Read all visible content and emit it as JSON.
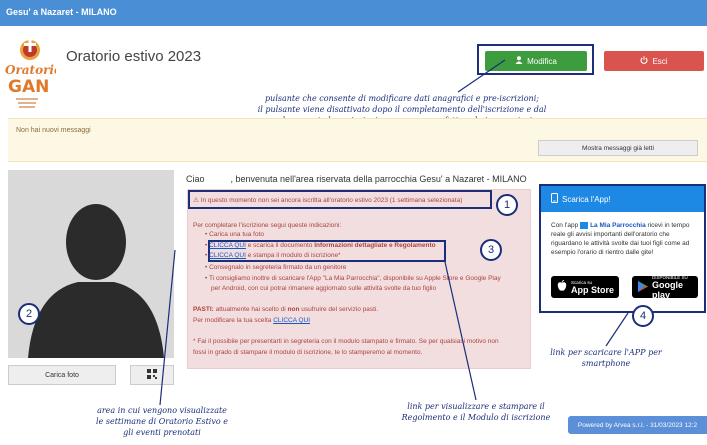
{
  "topbar": {
    "title": "Gesu' a Nazaret - MILANO"
  },
  "logo": {
    "text1": "Oratorio",
    "text2": "GAN"
  },
  "page_title": "Oratorio estivo 2023",
  "buttons": {
    "modifica": "Modifica",
    "esci": "Esci",
    "mostra_messaggi": "Mostra messaggi già letti",
    "carica_foto": "Carica foto"
  },
  "messages": {
    "none": "Non hai nuovi messaggi"
  },
  "welcome": {
    "ciao": "Ciao",
    "text": ", benvenuta nell'area riservata della parrocchia Gesu' a Nazaret - MILANO"
  },
  "alert": {
    "top": "In questo momento non sei ancora iscritta all'oratorio estivo 2023 (1 settimana selezionata)",
    "intro": "Per completare l'iscrizione segui queste indicazioni:",
    "step1": "Carica una tua foto",
    "step2_link": "CLICCA QUI",
    "step2_text": " e scarica il documento ",
    "step2_bold": "Informazioni dettagliate e Regolamento",
    "step3_link": "CLICCA QUI",
    "step3_text": " e stampa il modulo di iscrizione*",
    "step4": "Consegnalo in segreteria firmato da un genitore",
    "step5a": "Ti consigliamo inoltre di scaricare l'App \"La Mia Parrocchia\", disponibile su Apple Store e Google Play",
    "step5b": "per Android, con cui potrai rimanere aggiornato sulle attività svolte da tuo figlio",
    "pasti_label": "PASTI:",
    "pasti_text1": " attualmente hai scelto di ",
    "pasti_bold": "non",
    "pasti_text2": " usufruire del servizio pasti.",
    "pasti_mod": "Per modificare la tua scelta ",
    "pasti_link": "CLICCA QUI",
    "foot1": "* Fai il possibile per presentarti in segreteria con il modulo stampato e firmato. Se per qualsiasi motivo non",
    "foot2": "fossi in grado di stampare il modulo di iscrizione, te lo stamperemo al momento."
  },
  "app": {
    "title": "Scarica l'App!",
    "text_a": "Con l'app ",
    "brand": "La Mia Parrocchia",
    "text_b": " ricevi in tempo reale gli avvisi importanti dell'oratorio che riguardano le attività svolte dai tuoi figli come ad esempio l'orario di rientro dalle gite!",
    "appstore_small": "Scarica su",
    "appstore_big": "App Store",
    "googleplay_small": "DISPONIBILE SU",
    "googleplay_big": "Google play"
  },
  "annotations": {
    "modifica_1": "pulsante che consente di modificare dati anagrafici e pre-iscrizioni;",
    "modifica_2": "il pulsante viene disattivato dopo il completamento dell'iscrizione e dal",
    "modifica_3": "quel momento le variazioni possono essere fatte solo in segreteria",
    "area_1": "area in cui vengono visualizzate",
    "area_2": "le settimane di Oratorio Estivo e",
    "area_3": "gli eventi prenotati",
    "app_1": "link per scaricare l'APP per",
    "app_2": "smartphone",
    "links_1": "link per visualizzare e stampare il",
    "links_2": "Regolmento e il Modulo di iscrizione"
  },
  "callouts": [
    "1",
    "2",
    "3",
    "4"
  ],
  "footer": {
    "powered": "Powered by Arvea s.r.l. - 31/03/2023 12:2"
  },
  "colors": {
    "topbar": "#4a8fd6",
    "modifica": "#3d9c3d",
    "esci": "#d9534f",
    "alert_bg": "#f2dede",
    "alert_text": "#a94442",
    "annotation": "#1a2e7a",
    "app_header": "#1e88e5"
  }
}
